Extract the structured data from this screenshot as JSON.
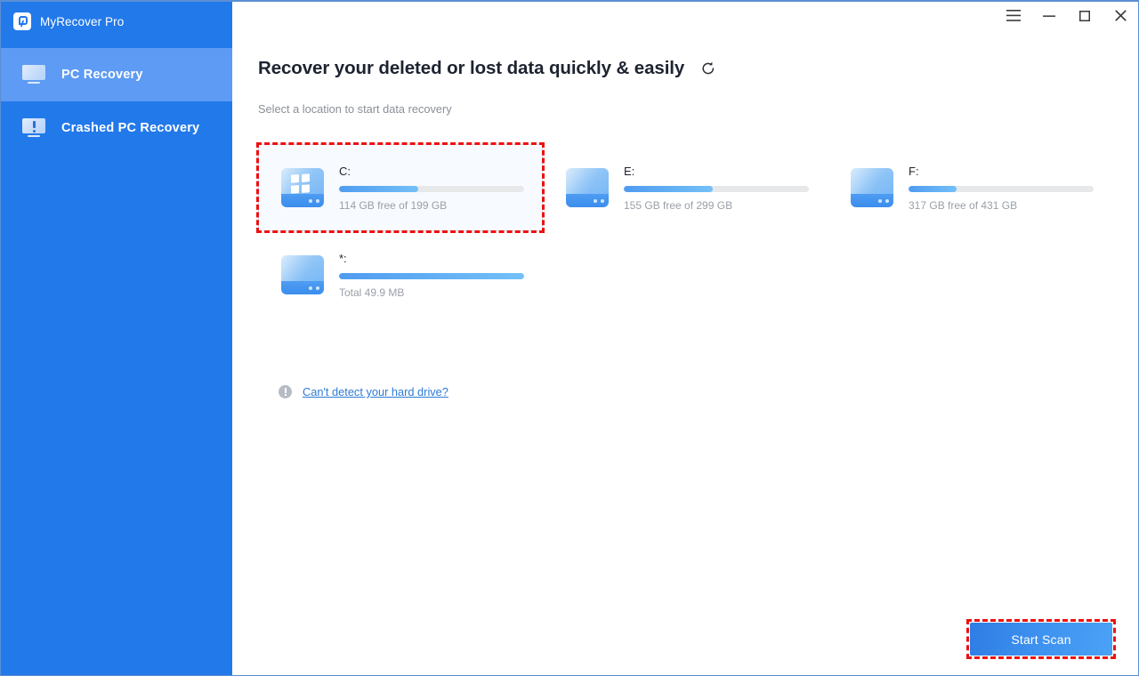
{
  "app": {
    "name": "MyRecover Pro",
    "logo_icon": "app-logo-icon"
  },
  "titlebar": {
    "menu_icon": "hamburger-menu-icon",
    "minimize_icon": "minimize-icon",
    "maximize_icon": "maximize-icon",
    "close_icon": "close-icon"
  },
  "sidebar": {
    "items": [
      {
        "label": "PC Recovery",
        "icon": "monitor-icon",
        "active": true
      },
      {
        "label": "Crashed PC Recovery",
        "icon": "monitor-alert-icon",
        "active": false
      }
    ]
  },
  "main": {
    "title": "Recover your deleted or lost data quickly & easily",
    "refresh_icon": "refresh-icon",
    "subtitle": "Select a location to start data recovery",
    "drives": [
      {
        "name": "C:",
        "capacity_text": "114 GB free of 199 GB",
        "used_percent": 43,
        "icon": "windows-drive-icon",
        "selected": true
      },
      {
        "name": "E:",
        "capacity_text": "155 GB free of 299 GB",
        "used_percent": 48,
        "icon": "drive-icon",
        "selected": false
      },
      {
        "name": "F:",
        "capacity_text": "317 GB free of 431 GB",
        "used_percent": 26,
        "icon": "drive-icon",
        "selected": false
      },
      {
        "name": "*:",
        "capacity_text": "Total 49.9 MB",
        "used_percent": 100,
        "icon": "drive-icon",
        "selected": false
      }
    ],
    "detect_link": "Can't detect your hard drive?",
    "detect_icon": "exclamation-circle-icon",
    "start_scan_label": "Start Scan"
  },
  "colors": {
    "sidebar_bg": "#2279ea",
    "sidebar_active": "#5d9bf4",
    "accent": "#3e92f0",
    "highlight_outline": "#ee1111",
    "link": "#2e7bd6",
    "muted_text": "#9aa0a8"
  }
}
